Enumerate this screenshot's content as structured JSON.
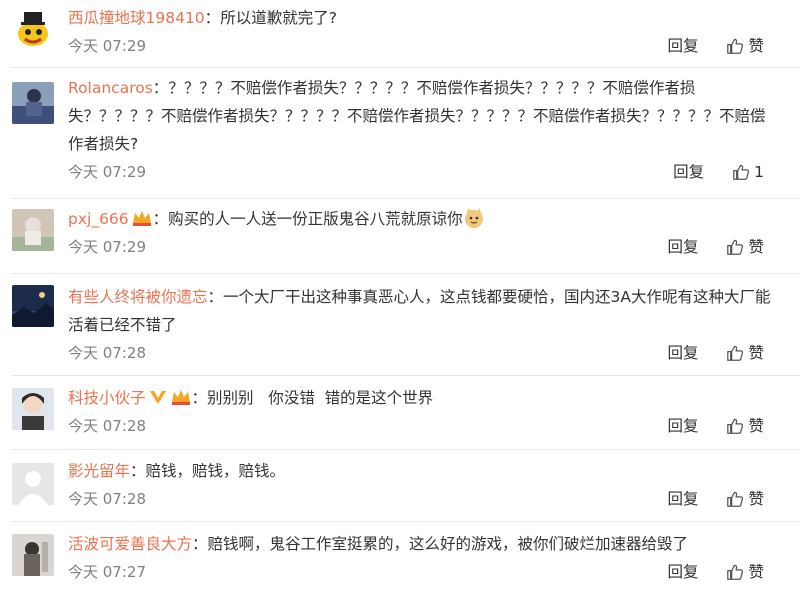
{
  "comments": [
    {
      "name": "西瓜撞地球198410",
      "text": "所以道歉就完了?",
      "time": "今天 07:29",
      "reply": "回复",
      "like": "赞"
    },
    {
      "name": "Rolancaros",
      "text": "？？？？不赔偿作者损失？？？？？不赔偿作者损失？？？？？不赔偿作者损失？？？？？不赔偿作者损失？？？？？不赔偿作者损失？？？？？不赔偿作者损失？？？？？不赔偿作者损失?",
      "time": "今天 07:29",
      "reply": "回复",
      "like": "1"
    },
    {
      "name": "pxj_666",
      "text": "购买的人一人送一份正版鬼谷八荒就原谅你",
      "time": "今天 07:29",
      "reply": "回复",
      "like": "赞"
    },
    {
      "name": "有些人终将被你遗忘",
      "text": "一个大厂干出这种事真恶心人，这点钱都要硬恰，国内还3A大作呢有这种大厂能活着已经不错了",
      "time": "今天 07:28",
      "reply": "回复",
      "like": "赞"
    },
    {
      "name": "科技小伙子",
      "text": "别别别   你没错  错的是这个世界",
      "time": "今天 07:28",
      "reply": "回复",
      "like": "赞"
    },
    {
      "name": "影光留年",
      "text": "赔钱，赔钱，赔钱。",
      "time": "今天 07:28",
      "reply": "回复",
      "like": "赞"
    },
    {
      "name": "活波可爱善良大方",
      "text": "赔钱啊，鬼谷工作室挺累的，这么好的游戏，被你们破烂加速器给毁了",
      "time": "今天 07:27",
      "reply": "回复",
      "like": "赞"
    }
  ],
  "colors": {
    "name": "#eb7350",
    "text": "#333333",
    "meta": "#808080",
    "divider": "#e6e6e6"
  }
}
